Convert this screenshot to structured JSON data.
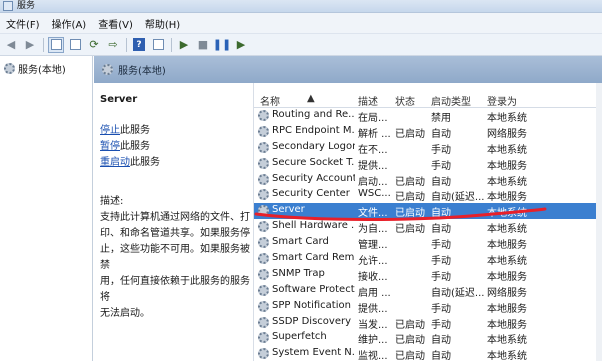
{
  "window": {
    "title": "服务"
  },
  "menu": [
    {
      "label": "文件(F)"
    },
    {
      "label": "操作(A)"
    },
    {
      "label": "查看(V)"
    },
    {
      "label": "帮助(H)"
    }
  ],
  "toolbar": {
    "help_label": "?"
  },
  "tree": {
    "root_label": "服务(本地)"
  },
  "header": {
    "title": "服务(本地)"
  },
  "detail": {
    "name": "Server",
    "links": [
      {
        "link": "停止",
        "rest": "此服务"
      },
      {
        "link": "暂停",
        "rest": "此服务"
      },
      {
        "link": "重启动",
        "rest": "此服务"
      }
    ],
    "desc_label": "描述:",
    "desc_lines": [
      "支持此计算机通过网络的文件、打",
      "印、和命名管道共享。如果服务停",
      "止，这些功能不可用。如果服务被禁",
      "用，任何直接依赖于此服务的服务将",
      "无法启动。"
    ]
  },
  "columns": {
    "name": "名称",
    "desc": "描述",
    "state": "状态",
    "type": "启动类型",
    "logon": "登录为"
  },
  "services": [
    {
      "name": "Routing and Re...",
      "desc": "在局...",
      "state": "",
      "type": "禁用",
      "logon": "本地系统"
    },
    {
      "name": "RPC Endpoint M...",
      "desc": "解析 ...",
      "state": "已启动",
      "type": "自动",
      "logon": "网络服务"
    },
    {
      "name": "Secondary Logon",
      "desc": "在不...",
      "state": "",
      "type": "手动",
      "logon": "本地系统"
    },
    {
      "name": "Secure Socket T...",
      "desc": "提供...",
      "state": "",
      "type": "手动",
      "logon": "本地服务"
    },
    {
      "name": "Security Account...",
      "desc": "启动...",
      "state": "已启动",
      "type": "自动",
      "logon": "本地系统"
    },
    {
      "name": "Security Center",
      "desc": "WSC...",
      "state": "已启动",
      "type": "自动(延迟...",
      "logon": "本地服务"
    },
    {
      "name": "Server",
      "desc": "文件...",
      "state": "已启动",
      "type": "自动",
      "logon": "本地系统",
      "selected": true
    },
    {
      "name": "Shell Hardware ...",
      "desc": "为自...",
      "state": "已启动",
      "type": "自动",
      "logon": "本地系统"
    },
    {
      "name": "Smart Card",
      "desc": "管理...",
      "state": "",
      "type": "手动",
      "logon": "本地服务"
    },
    {
      "name": "Smart Card Rem...",
      "desc": "允许...",
      "state": "",
      "type": "手动",
      "logon": "本地系统"
    },
    {
      "name": "SNMP Trap",
      "desc": "接收...",
      "state": "",
      "type": "手动",
      "logon": "本地服务"
    },
    {
      "name": "Software Protect...",
      "desc": "启用 ...",
      "state": "",
      "type": "自动(延迟...",
      "logon": "网络服务"
    },
    {
      "name": "SPP Notification ...",
      "desc": "提供...",
      "state": "",
      "type": "手动",
      "logon": "本地服务"
    },
    {
      "name": "SSDP Discovery",
      "desc": "当发...",
      "state": "已启动",
      "type": "手动",
      "logon": "本地服务"
    },
    {
      "name": "Superfetch",
      "desc": "维护...",
      "state": "已启动",
      "type": "自动",
      "logon": "本地系统"
    },
    {
      "name": "System Event N...",
      "desc": "监视...",
      "state": "已启动",
      "type": "自动",
      "logon": "本地系统"
    }
  ],
  "colors": {
    "selection": "#3b7fd0",
    "annotation": "#e8202a",
    "header_band": "#9fb6d3"
  }
}
